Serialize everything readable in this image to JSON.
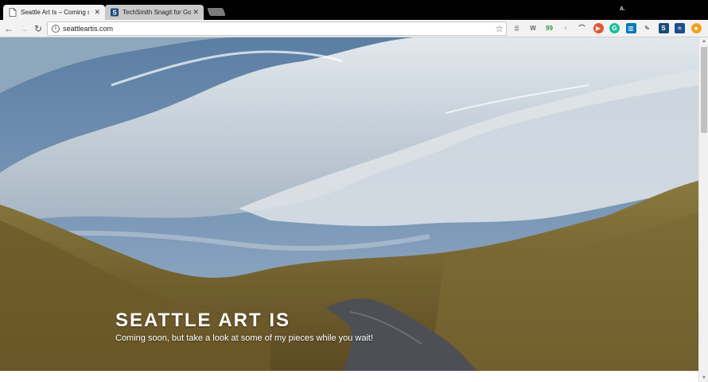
{
  "browser": {
    "tabs": [
      {
        "title": "Seattle Art Is – Coming s",
        "favicon": "page-icon",
        "active": true
      },
      {
        "title": "TechSmith Snagit for Go",
        "favicon": "snagit-icon",
        "active": false
      }
    ],
    "profile_label": "A.",
    "nav": {
      "back": "←",
      "forward": "→",
      "reload": "↻"
    },
    "address": {
      "url": "seattleartis.com",
      "info_icon": "i",
      "bookmark_icon": "☆"
    },
    "extensions": [
      {
        "name": "reader-icon",
        "glyph": "≣",
        "color": "#888888",
        "bg": "transparent"
      },
      {
        "name": "wordpress-icon",
        "glyph": "W",
        "color": "#666666",
        "bg": "transparent"
      },
      {
        "name": "quote-icon",
        "glyph": "99",
        "color": "#2e9e44",
        "bg": "transparent"
      },
      {
        "name": "pin-icon",
        "glyph": "♀",
        "color": "#888888",
        "bg": "transparent"
      },
      {
        "name": "arc-icon",
        "glyph": "⌒",
        "color": "#444444",
        "bg": "transparent"
      },
      {
        "name": "play-icon",
        "glyph": "▶",
        "color": "#ffffff",
        "bg": "#e8542b"
      },
      {
        "name": "grammarly-icon",
        "glyph": "G",
        "color": "#ffffff",
        "bg": "#15c39a"
      },
      {
        "name": "trello-icon",
        "glyph": "▥",
        "color": "#ffffff",
        "bg": "#0079bf"
      },
      {
        "name": "eyedropper-icon",
        "glyph": "✎",
        "color": "#222222",
        "bg": "transparent"
      },
      {
        "name": "snagit-ext-icon",
        "glyph": "S",
        "color": "#ffffff",
        "bg": "#1a4c7a"
      },
      {
        "name": "analytics-icon",
        "glyph": "≈",
        "color": "#ffffff",
        "bg": "#1e4e8c"
      },
      {
        "name": "coin-icon",
        "glyph": "●",
        "color": "#ffffff",
        "bg": "#f2a31b"
      }
    ]
  },
  "site": {
    "title": "SEATTLE ART IS",
    "description": "Coming soon, but take a look at some of my pieces while you wait!"
  },
  "scrollbar": {
    "up": "▲",
    "down": "▼"
  }
}
